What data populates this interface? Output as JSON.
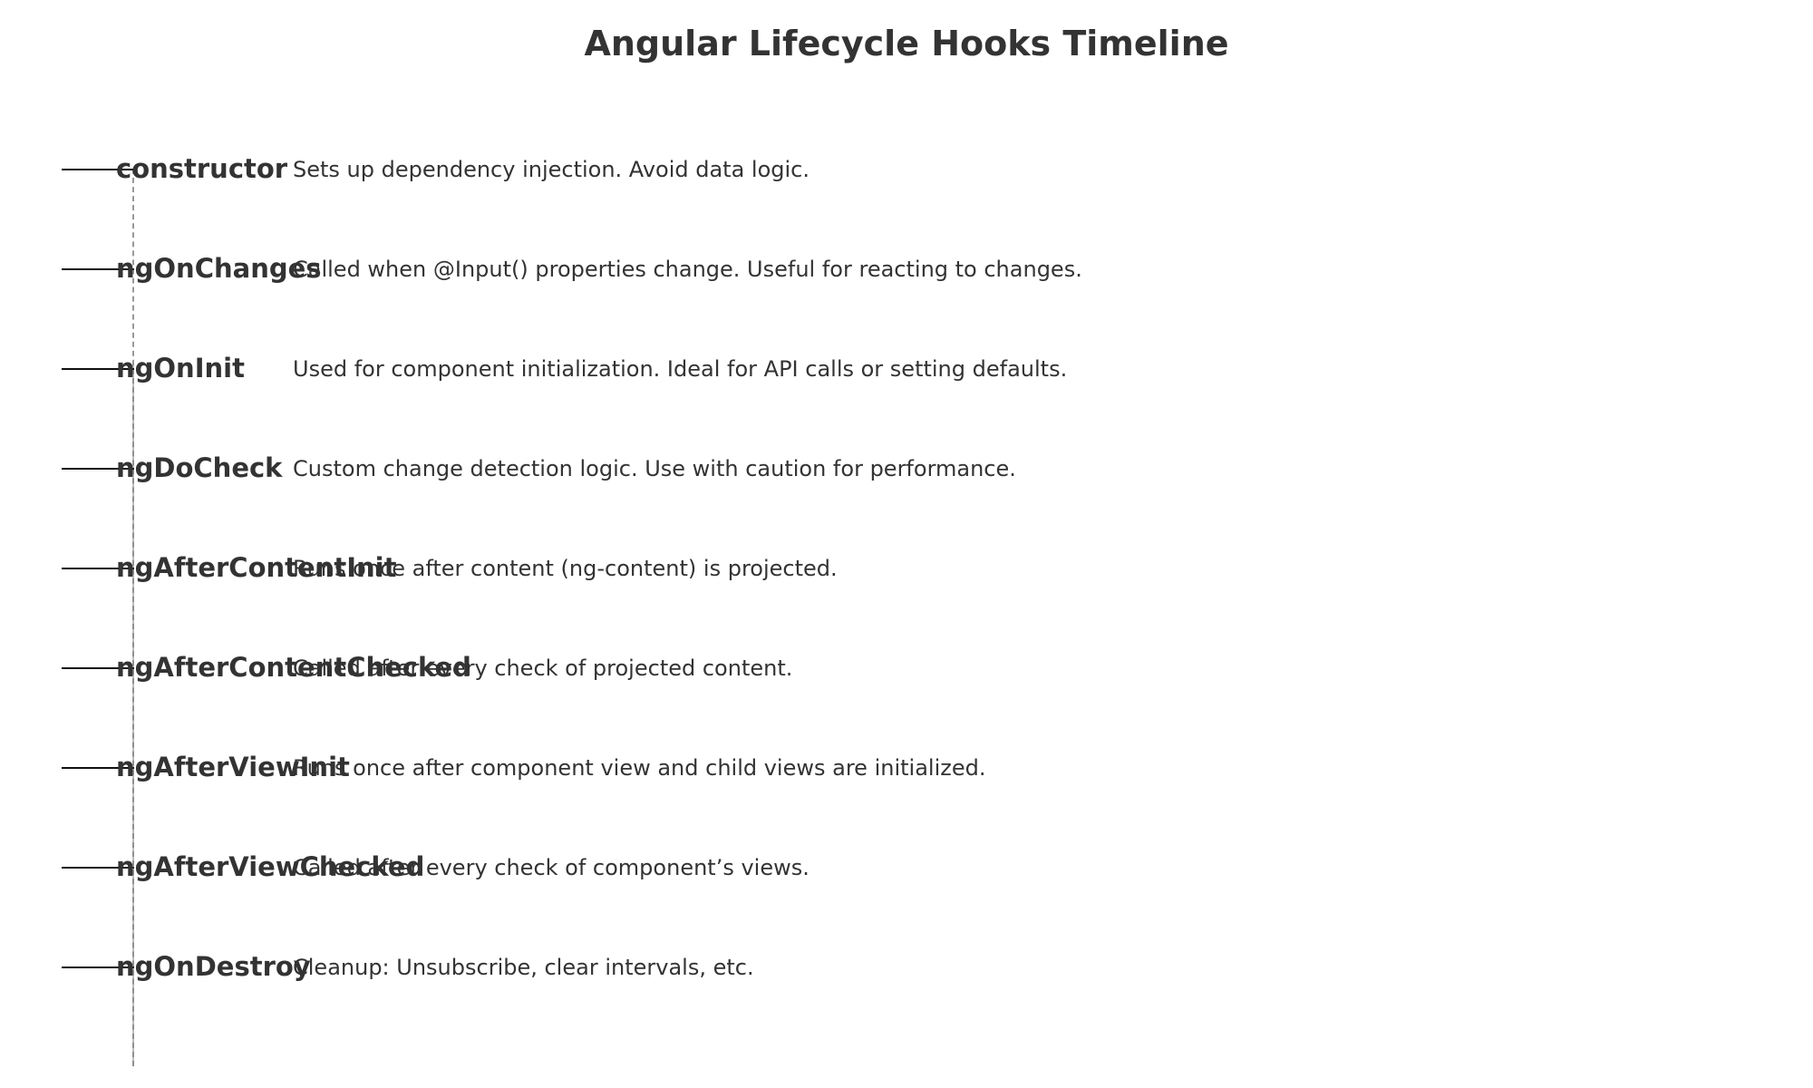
{
  "title": "Angular Lifecycle Hooks Timeline",
  "colors": {
    "text": "#333333",
    "tick": "#111111",
    "axis": "#999999"
  },
  "hooks": [
    {
      "name": "constructor",
      "description": "Sets up dependency injection. Avoid data logic."
    },
    {
      "name": "ngOnChanges",
      "description": "Called when @Input() properties change. Useful for reacting to changes."
    },
    {
      "name": "ngOnInit",
      "description": "Used for component initialization. Ideal for API calls or setting defaults."
    },
    {
      "name": "ngDoCheck",
      "description": "Custom change detection logic. Use with caution for performance."
    },
    {
      "name": "ngAfterContentInit",
      "description": "Runs once after content (ng-content) is projected."
    },
    {
      "name": "ngAfterContentChecked",
      "description": "Called after every check of projected content."
    },
    {
      "name": "ngAfterViewInit",
      "description": "Runs once after component view and child views are initialized."
    },
    {
      "name": "ngAfterViewChecked",
      "description": "Called after every check of component’s views."
    },
    {
      "name": "ngOnDestroy",
      "description": "Cleanup: Unsubscribe, clear intervals, etc."
    }
  ]
}
